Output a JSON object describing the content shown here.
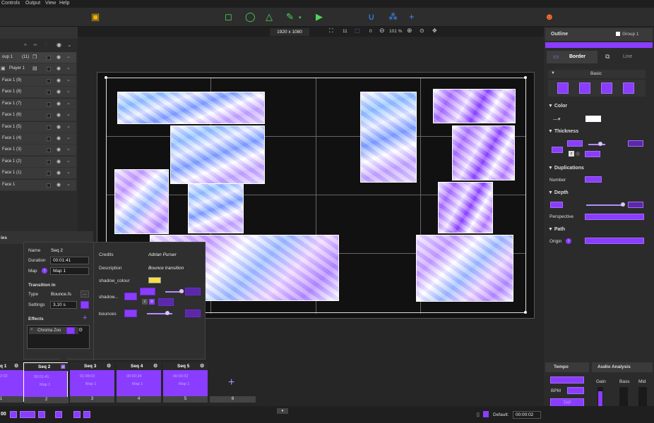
{
  "menu": {
    "items": [
      "Controls",
      "Output",
      "View",
      "Help"
    ]
  },
  "canvas_bar": {
    "resolution": "1920 x 1080",
    "grid_count": "11",
    "grid_value": "0",
    "zoom": "101 %"
  },
  "layers": {
    "group": {
      "label": "oup 1",
      "count": "(11)"
    },
    "player": {
      "label": "Player 1"
    },
    "faces": [
      "Face 1 (9)",
      "Face 1 (8)",
      "Face 1 (7)",
      "Face 1 (6)",
      "Face 1 (5)",
      "Face 1 (4)",
      "Face 1 (3)",
      "Face 1 (2)",
      "Face 1 (1)",
      "Face 1"
    ]
  },
  "props_title": "ies",
  "popup": {
    "name_label": "Name",
    "name_value": "Seq 2",
    "duration_label": "Duration",
    "duration_value": "00:01:41",
    "map_label": "Map",
    "map_value": "Map 1",
    "transition_title": "Transition in",
    "type_label": "Type",
    "type_value": "Bounce.fs",
    "settings_label": "Settings",
    "settings_value": "3,10 s",
    "effects_title": "Effects",
    "effect_item": "Chroma Zoo",
    "credits_label": "Credits",
    "credits_value": "Adrian Purser",
    "description_label": "Description",
    "description_value": "Bounce transition",
    "shadow_colour_label": "shadow_colour",
    "shadow_label": "shadow...",
    "bounces_label": "bounces",
    "shadow_colour": "#f5e04a"
  },
  "right": {
    "outline_title": "Outline",
    "group_label": "Group 1",
    "tab_border": "Border",
    "tab_line": "Line",
    "basic": "Basic",
    "color_title": "Color",
    "thickness_title": "Thickness",
    "duplications_title": "Duplications",
    "number_label": "Number",
    "depth_title": "Depth",
    "perspective_label": "Perspective",
    "path_title": "Path",
    "origin_label": "Origin"
  },
  "timeline": {
    "sequences": [
      {
        "label": "q 1",
        "num": "1",
        "time": "2:02"
      },
      {
        "label": "Seq 2",
        "num": "2",
        "time": "00:01:41",
        "map": "Map 1"
      },
      {
        "label": "Seq 3",
        "num": "3",
        "time": "01:08:02",
        "map": "Map 1"
      },
      {
        "label": "Seq 4",
        "num": "4",
        "time": "00:00:34",
        "map": "Map 1"
      },
      {
        "label": "Seq 5",
        "num": "5",
        "time": "00:00:32",
        "map": "Map 1"
      }
    ],
    "empty_slot": "6"
  },
  "tempo": {
    "title": "Tempo",
    "bpm_label": "BPM",
    "audio_title": "Audio Analysis",
    "gain": "Gain",
    "bass": "Bass",
    "mid": "Mid",
    "tap": "TAP"
  },
  "bottom": {
    "time_left": "00",
    "default_label": "Default:",
    "default_value": "00:00:02"
  },
  "colors": {
    "accent": "#8a3dff"
  }
}
